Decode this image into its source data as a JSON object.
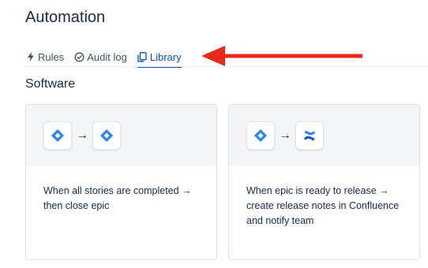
{
  "header": {
    "title": "Automation"
  },
  "tabs": [
    {
      "label": "Rules",
      "icon": "lightning-icon",
      "active": false
    },
    {
      "label": "Audit log",
      "icon": "check-circle-icon",
      "active": false
    },
    {
      "label": "Library",
      "icon": "copy-icon",
      "active": true
    }
  ],
  "annotation": {
    "icon": "red-arrow-left-icon",
    "color": "#e8291c"
  },
  "section": {
    "title": "Software"
  },
  "cards": [
    {
      "from_icon": "jira-icon",
      "to_icon": "jira-icon",
      "arrow": "→",
      "description": "When all stories are completed → then close epic"
    },
    {
      "from_icon": "jira-icon",
      "to_icon": "confluence-icon",
      "arrow": "→",
      "description": "When epic is ready to release → create release notes in Confluence and notify team"
    }
  ],
  "colors": {
    "accent": "#0052cc",
    "jira_blue": "#2684ff",
    "text": "#172b4d",
    "muted": "#42526e"
  }
}
